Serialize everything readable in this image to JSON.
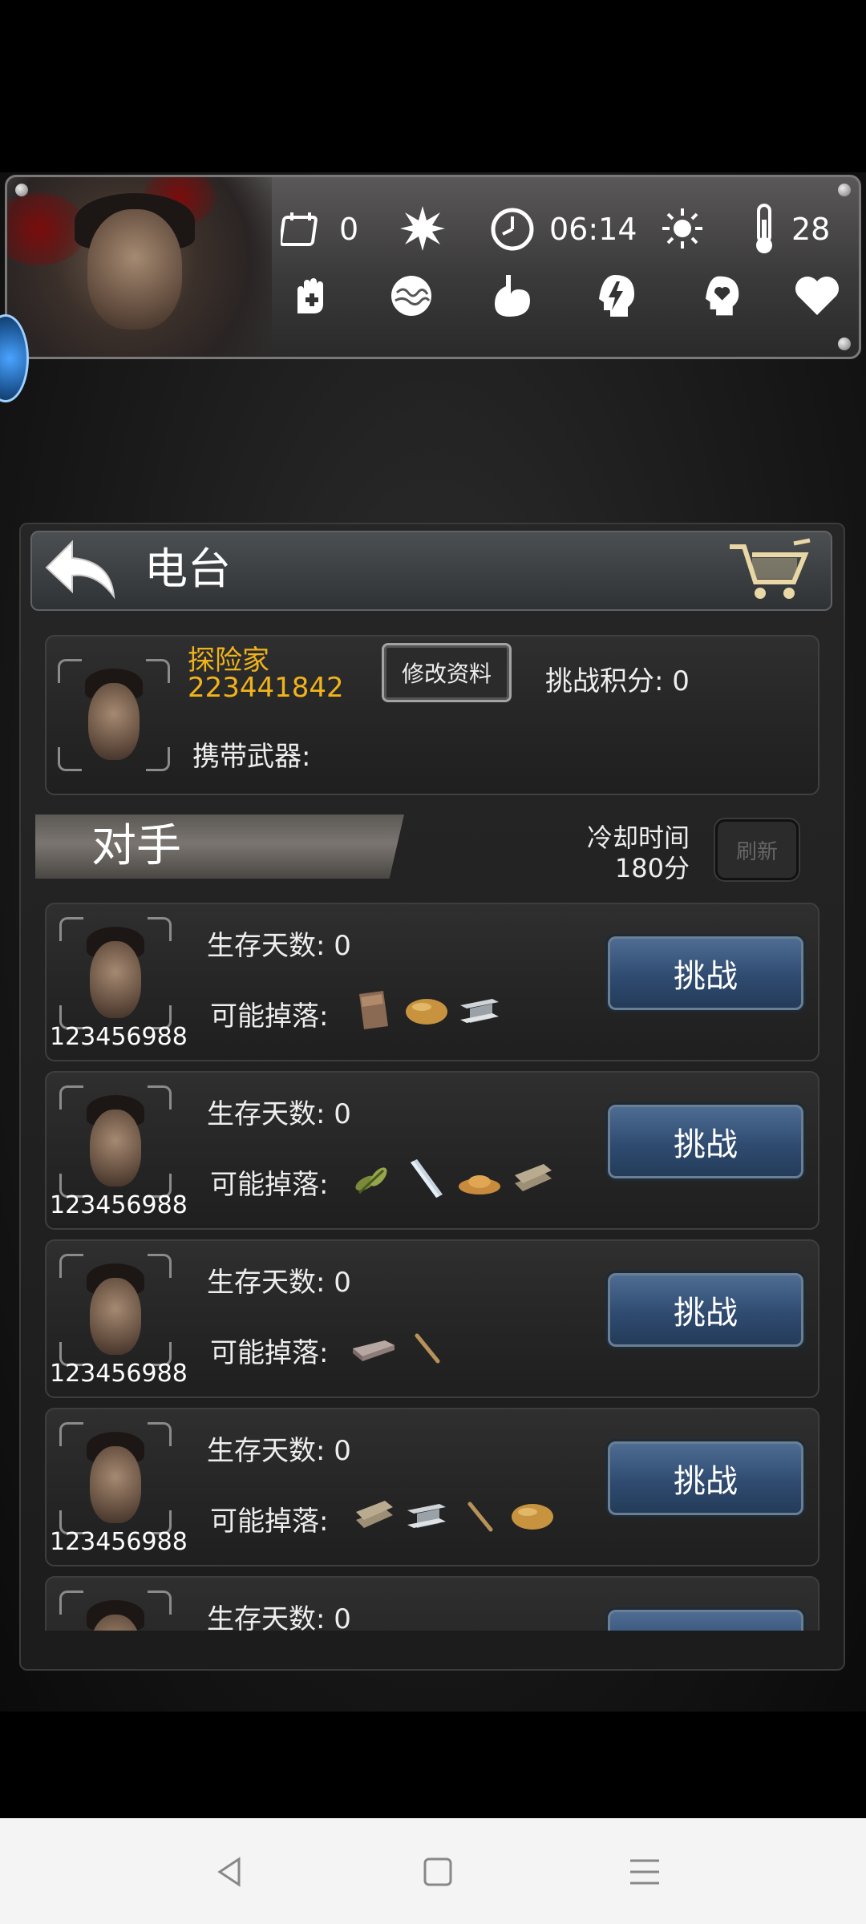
{
  "hud": {
    "calendar_value": "0",
    "time": "06:14",
    "temperature": "28",
    "icons_row1": [
      "calendar-icon",
      "sun-burst-icon",
      "clock-icon",
      "weather-sun-icon",
      "thermometer-icon"
    ],
    "icons_row2": [
      "medical-hand-icon",
      "brain-icon",
      "stomach-icon",
      "head-energy-icon",
      "mood-head-icon",
      "heart-icon"
    ]
  },
  "header": {
    "title": "电台"
  },
  "profile": {
    "name": "探险家",
    "id": "223441842",
    "edit_label": "修改资料",
    "score_label": "挑战积分: 0",
    "weapon_label": "携带武器:"
  },
  "opponents_section": {
    "title": "对手",
    "cooldown_label": "冷却时间",
    "cooldown_value": "180分",
    "refresh_label": "刷新"
  },
  "opponents": [
    {
      "id": "123456988",
      "days_label": "生存天数: 0",
      "drops_label": "可能掉落:",
      "drops": [
        "plank-icon",
        "potato-icon",
        "steel-beam-icon"
      ],
      "button": "挑战"
    },
    {
      "id": "123456988",
      "days_label": "生存天数: 0",
      "drops_label": "可能掉落:",
      "drops": [
        "herb-icon",
        "metal-tube-icon",
        "sawdust-icon",
        "wood-board-icon"
      ],
      "button": "挑战"
    },
    {
      "id": "123456988",
      "days_label": "生存天数: 0",
      "drops_label": "可能掉落:",
      "drops": [
        "stone-slab-icon",
        "stick-icon"
      ],
      "button": "挑战"
    },
    {
      "id": "123456988",
      "days_label": "生存天数: 0",
      "drops_label": "可能掉落:",
      "drops": [
        "wood-board-icon",
        "steel-beam-icon",
        "stick-icon",
        "potato-icon"
      ],
      "button": "挑战"
    },
    {
      "id": "",
      "days_label": "生存天数: 0",
      "drops_label": "",
      "drops": [],
      "button": ""
    }
  ],
  "colors": {
    "accent_gold": "#f0b31c",
    "button_blue": "#2f4b70"
  },
  "nav": {
    "icons": [
      "back-triangle-icon",
      "home-square-icon",
      "menu-lines-icon"
    ]
  }
}
